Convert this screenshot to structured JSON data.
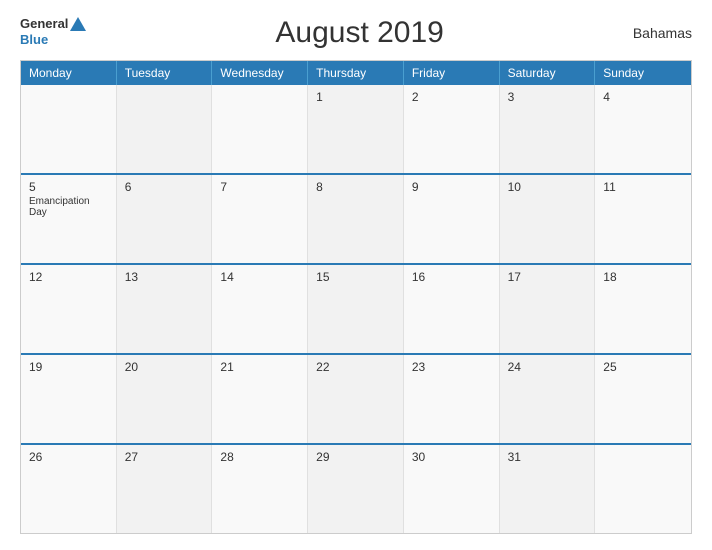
{
  "header": {
    "logo_general": "General",
    "logo_blue": "Blue",
    "title": "August 2019",
    "country": "Bahamas"
  },
  "calendar": {
    "days_header": [
      "Monday",
      "Tuesday",
      "Wednesday",
      "Thursday",
      "Friday",
      "Saturday",
      "Sunday"
    ],
    "weeks": [
      {
        "cells": [
          {
            "day": "",
            "event": ""
          },
          {
            "day": "",
            "event": ""
          },
          {
            "day": "",
            "event": ""
          },
          {
            "day": "1",
            "event": ""
          },
          {
            "day": "2",
            "event": ""
          },
          {
            "day": "3",
            "event": ""
          },
          {
            "day": "4",
            "event": ""
          }
        ]
      },
      {
        "cells": [
          {
            "day": "5",
            "event": "Emancipation Day"
          },
          {
            "day": "6",
            "event": ""
          },
          {
            "day": "7",
            "event": ""
          },
          {
            "day": "8",
            "event": ""
          },
          {
            "day": "9",
            "event": ""
          },
          {
            "day": "10",
            "event": ""
          },
          {
            "day": "11",
            "event": ""
          }
        ]
      },
      {
        "cells": [
          {
            "day": "12",
            "event": ""
          },
          {
            "day": "13",
            "event": ""
          },
          {
            "day": "14",
            "event": ""
          },
          {
            "day": "15",
            "event": ""
          },
          {
            "day": "16",
            "event": ""
          },
          {
            "day": "17",
            "event": ""
          },
          {
            "day": "18",
            "event": ""
          }
        ]
      },
      {
        "cells": [
          {
            "day": "19",
            "event": ""
          },
          {
            "day": "20",
            "event": ""
          },
          {
            "day": "21",
            "event": ""
          },
          {
            "day": "22",
            "event": ""
          },
          {
            "day": "23",
            "event": ""
          },
          {
            "day": "24",
            "event": ""
          },
          {
            "day": "25",
            "event": ""
          }
        ]
      },
      {
        "cells": [
          {
            "day": "26",
            "event": ""
          },
          {
            "day": "27",
            "event": ""
          },
          {
            "day": "28",
            "event": ""
          },
          {
            "day": "29",
            "event": ""
          },
          {
            "day": "30",
            "event": ""
          },
          {
            "day": "31",
            "event": ""
          },
          {
            "day": "",
            "event": ""
          }
        ]
      }
    ]
  }
}
